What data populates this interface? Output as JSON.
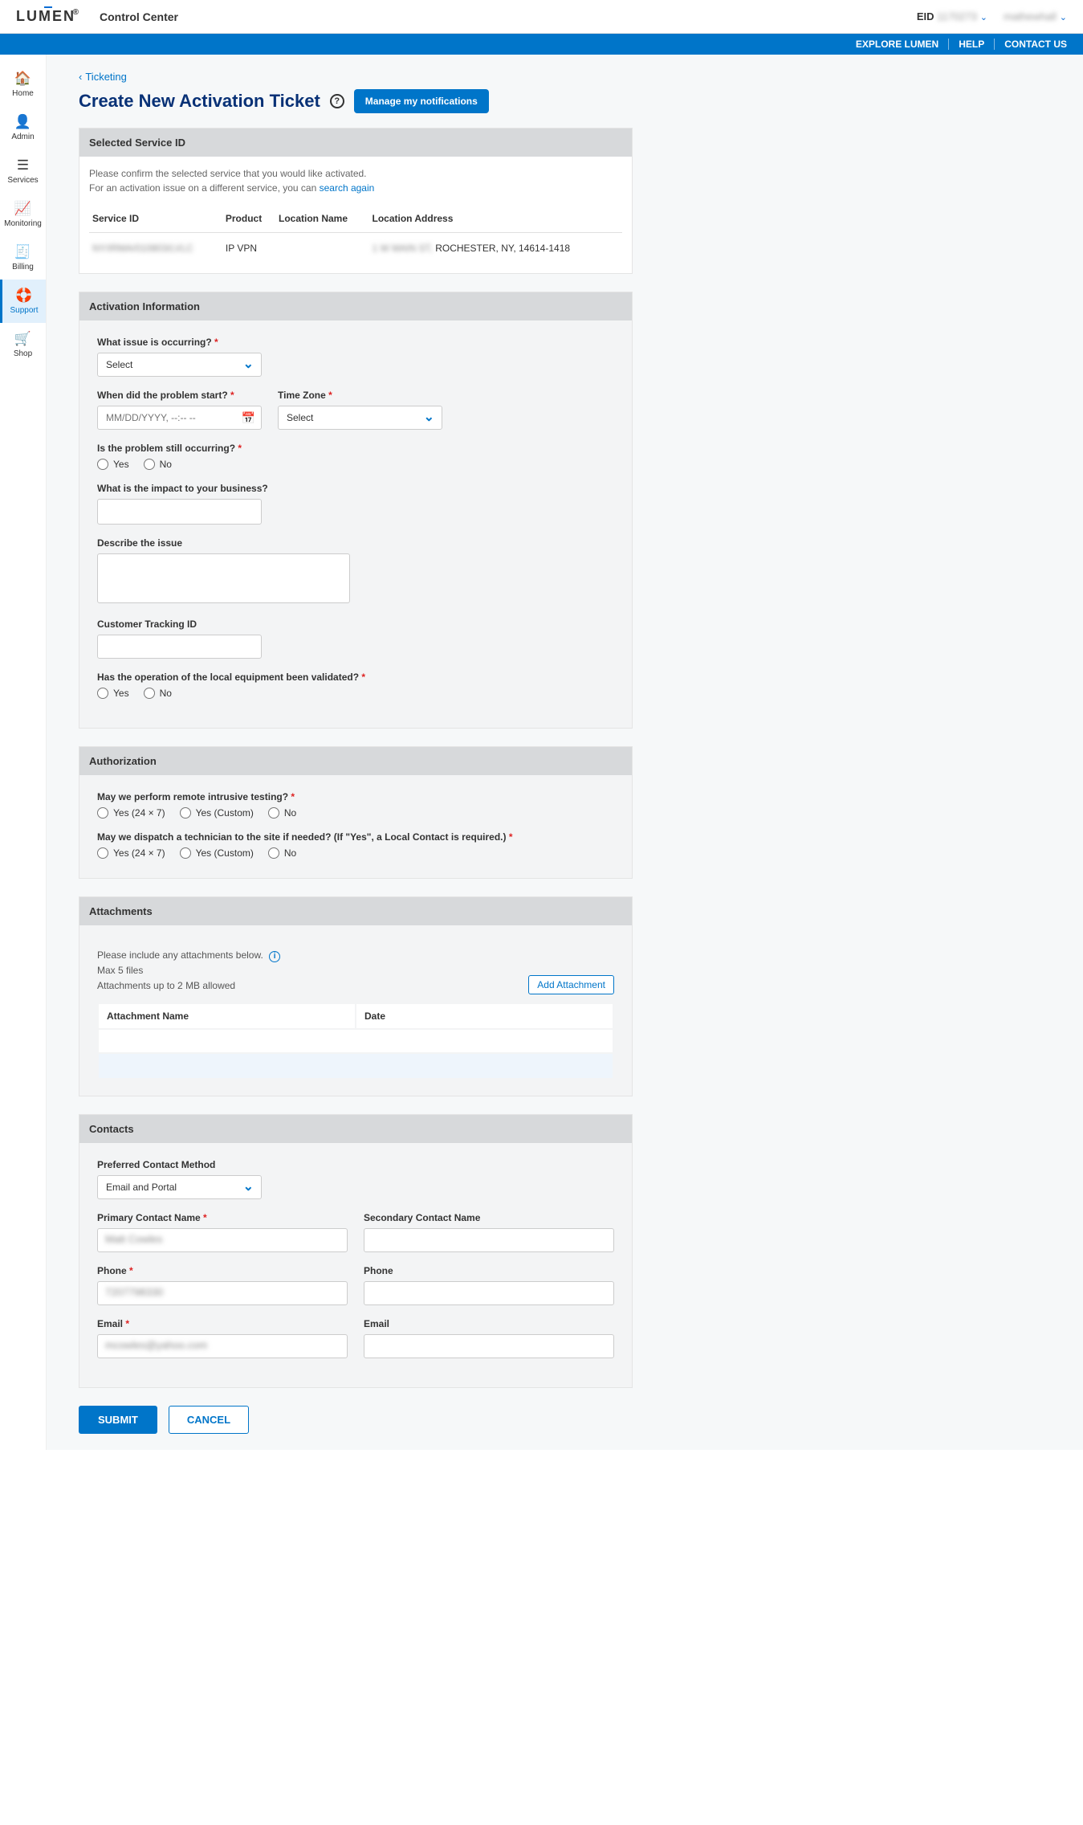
{
  "header": {
    "logo_text": "LUMEN",
    "app_title": "Control Center",
    "eid_label": "EID",
    "eid_value": "1170273",
    "username": "mathewhall"
  },
  "bluebar": {
    "explore": "EXPLORE LUMEN",
    "help": "HELP",
    "contact": "CONTACT US"
  },
  "sidebar": {
    "items": [
      {
        "label": "Home",
        "icon": "⌂"
      },
      {
        "label": "Admin",
        "icon": "☻"
      },
      {
        "label": "Services",
        "icon": "≣"
      },
      {
        "label": "Monitoring",
        "icon": "∿"
      },
      {
        "label": "Billing",
        "icon": "▤"
      },
      {
        "label": "Support",
        "icon": "☺"
      },
      {
        "label": "Shop",
        "icon": "🛒"
      }
    ]
  },
  "breadcrumb": {
    "label": "Ticketing"
  },
  "page": {
    "title": "Create New Activation Ticket",
    "manage_btn": "Manage my notifications"
  },
  "selected_service": {
    "header": "Selected Service ID",
    "hint1": "Please confirm the selected service that you would like activated.",
    "hint2_a": "For an activation issue on a different service, you can ",
    "hint2_link": "search again",
    "columns": {
      "service_id": "Service ID",
      "product": "Product",
      "location_name": "Location Name",
      "location_address": "Location Address"
    },
    "row": {
      "service_id": "NY/IRMA/010803/LVLC",
      "product": "IP VPN",
      "location_name": "",
      "location_addr_blur": "1 W MAIN ST,",
      "location_addr_clear": "ROCHESTER, NY, 14614-1418"
    }
  },
  "activation": {
    "header": "Activation Information",
    "issue_label": "What issue is occurring?",
    "issue_placeholder": "Select",
    "when_label": "When did the problem start?",
    "when_placeholder": "MM/DD/YYYY, --:-- --",
    "tz_label": "Time Zone",
    "tz_placeholder": "Select",
    "still_label": "Is the problem still occurring?",
    "opt_yes": "Yes",
    "opt_no": "No",
    "impact_label": "What is the impact to your business?",
    "describe_label": "Describe the issue",
    "tracking_label": "Customer Tracking ID",
    "validated_label": "Has the operation of the local equipment been validated?"
  },
  "authorization": {
    "header": "Authorization",
    "remote_label": "May we perform remote intrusive testing?",
    "dispatch_label": "May we dispatch a technician to the site if needed? (If \"Yes\", a Local Contact is required.)",
    "opt_yes247": "Yes (24 × 7)",
    "opt_yescustom": "Yes (Custom)",
    "opt_no": "No"
  },
  "attachments": {
    "header": "Attachments",
    "hint1": "Please include any attachments below.",
    "hint2": "Max 5 files",
    "hint3": "Attachments up to 2 MB allowed",
    "add_btn": "Add Attachment",
    "col_name": "Attachment Name",
    "col_date": "Date"
  },
  "contacts": {
    "header": "Contacts",
    "method_label": "Preferred Contact Method",
    "method_value": "Email and Portal",
    "p_name_label": "Primary Contact Name",
    "p_phone_label": "Phone",
    "p_email_label": "Email",
    "s_name_label": "Secondary Contact Name",
    "s_phone_label": "Phone",
    "s_email_label": "Email",
    "p_name_value": "Matt Cowles",
    "p_phone_value": "7207798330",
    "p_email_value": "mcowles@yahoo.com"
  },
  "actions": {
    "submit": "SUBMIT",
    "cancel": "CANCEL"
  }
}
